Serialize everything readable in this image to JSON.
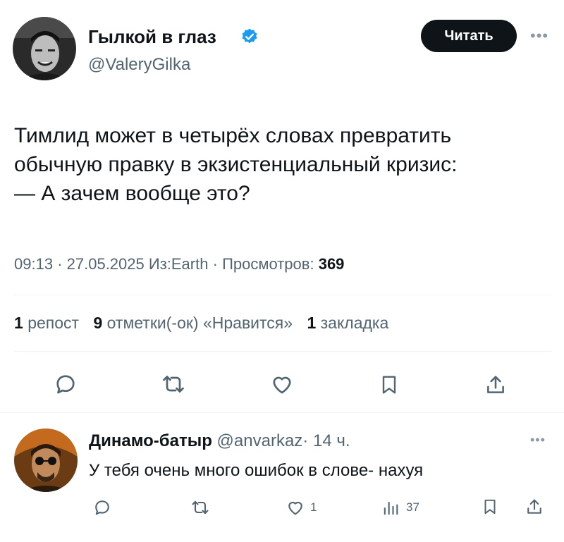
{
  "author": {
    "name": "Гылкой в глаз",
    "handle": "@ValeryGilka",
    "verified_color": "#1d9bf0"
  },
  "read_button": "Читать",
  "more_icon": "•••",
  "tweet": {
    "lines": [
      "Тимлид может в четырёх словах превратить",
      "обычную правку в экзистенциальный кризис:",
      "— А зачем вообще это?"
    ],
    "time": "09:13",
    "date": "27.05.2025",
    "source": "Из:Earth",
    "views_label": "Просмотров:",
    "views_value": "369",
    "sep": "·"
  },
  "stats": {
    "reposts_count": "1",
    "reposts_label": "репост",
    "likes_count": "9",
    "likes_label": "отметки(-ок) «Нравится»",
    "bookmarks_count": "1",
    "bookmarks_label": "закладка"
  },
  "actions": [
    "reply-icon",
    "retweet-icon",
    "heart-icon",
    "bookmark-icon",
    "share-icon"
  ],
  "reply": {
    "name": "Динамо-батыр",
    "handle": "@anvarkaz",
    "sep": "·",
    "time": "14 ч.",
    "text": "У тебя очень много ошибок в слове- нахуя",
    "likes": "1",
    "views": "37"
  }
}
